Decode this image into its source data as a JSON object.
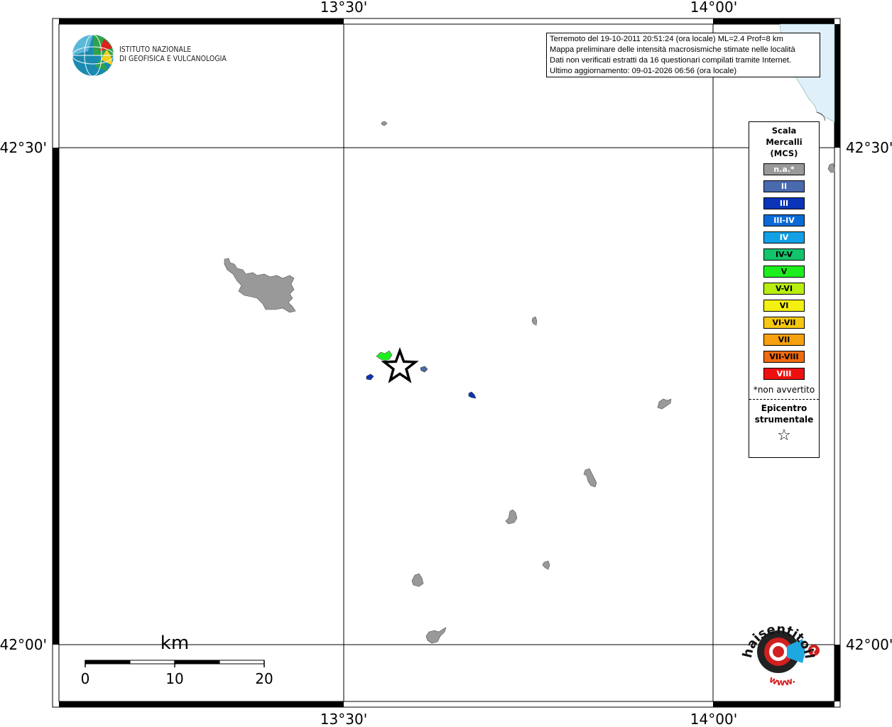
{
  "coordinates": {
    "top": [
      "13°30'",
      "14°00'"
    ],
    "bottom": [
      "13°30'",
      "14°00'"
    ],
    "left": [
      "42°30'",
      "42°00'"
    ],
    "right": [
      "42°30'",
      "42°00'"
    ]
  },
  "info_box": {
    "line1": "Terremoto del 19-10-2011 20:51:24 (ora locale) ML=2.4 Prof=8 km",
    "line2": "Mappa preliminare delle intensità macrosismiche stimate nelle località",
    "line3": "Dati non verificati estratti da 16 questionari compilati tramite Internet.",
    "line4": "Ultimo aggiornamento: 09-01-2026 06:56 (ora locale)"
  },
  "institute_logo": {
    "line1": "ISTITUTO NAZIONALE",
    "line2": "DI GEOFISICA E VULCANOLOGIA"
  },
  "legend": {
    "title_line1": "Scala",
    "title_line2": "Mercalli",
    "title_line3": "(MCS)",
    "items": [
      {
        "label": "n.a.*",
        "color": "#999999",
        "text_color": "#ffffff"
      },
      {
        "label": "II",
        "color": "#4a6aae",
        "text_color": "#ffffff"
      },
      {
        "label": "III",
        "color": "#0b35b8",
        "text_color": "#ffffff"
      },
      {
        "label": "III-IV",
        "color": "#0a6ad8",
        "text_color": "#ffffff"
      },
      {
        "label": "IV",
        "color": "#12a0e6",
        "text_color": "#ffffff"
      },
      {
        "label": "IV-V",
        "color": "#12c46c",
        "text_color": "#000000"
      },
      {
        "label": "V",
        "color": "#1eee1e",
        "text_color": "#000000"
      },
      {
        "label": "V-VI",
        "color": "#b8ee10",
        "text_color": "#000000"
      },
      {
        "label": "VI",
        "color": "#f4f010",
        "text_color": "#000000"
      },
      {
        "label": "VI-VII",
        "color": "#f6c812",
        "text_color": "#000000"
      },
      {
        "label": "VII",
        "color": "#f6a010",
        "text_color": "#000000"
      },
      {
        "label": "VII-VIII",
        "color": "#f06a10",
        "text_color": "#000000"
      },
      {
        "label": "VIII",
        "color": "#ee1010",
        "text_color": "#ffffff"
      }
    ],
    "note": "*non avvertito",
    "epicenter_line1": "Epicentro",
    "epicenter_line2": "strumentale",
    "epicenter_symbol": "☆"
  },
  "scale_bar": {
    "unit": "km",
    "ticks": [
      "0",
      "10",
      "20"
    ]
  },
  "hsit_logo": {
    "text": "haisentitoilterremoto.it",
    "www": "www.",
    "question": "?"
  },
  "colors": {
    "not_available": "#999999",
    "intensity_II": "#4a6aae",
    "intensity_III": "#0b35b8",
    "intensity_V": "#1eee1e",
    "sea": "#dff0fa"
  }
}
